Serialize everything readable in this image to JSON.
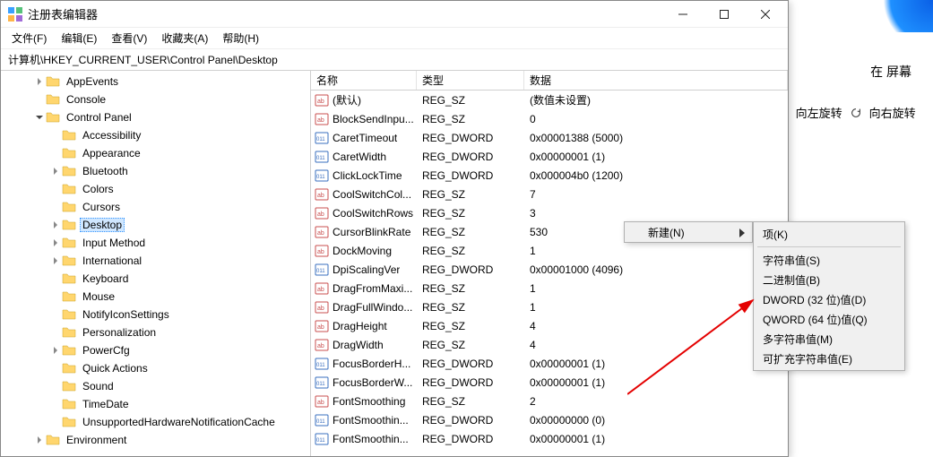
{
  "window": {
    "title": "注册表编辑器",
    "address": "计算机\\HKEY_CURRENT_USER\\Control Panel\\Desktop",
    "menu": [
      "文件(F)",
      "编辑(E)",
      "查看(V)",
      "收藏夹(A)",
      "帮助(H)"
    ]
  },
  "tree": [
    {
      "indent": 2,
      "arrow": "right",
      "label": "AppEvents"
    },
    {
      "indent": 2,
      "arrow": "none",
      "label": "Console"
    },
    {
      "indent": 2,
      "arrow": "down",
      "label": "Control Panel"
    },
    {
      "indent": 3,
      "arrow": "none",
      "label": "Accessibility"
    },
    {
      "indent": 3,
      "arrow": "none",
      "label": "Appearance"
    },
    {
      "indent": 3,
      "arrow": "right",
      "label": "Bluetooth"
    },
    {
      "indent": 3,
      "arrow": "none",
      "label": "Colors"
    },
    {
      "indent": 3,
      "arrow": "none",
      "label": "Cursors"
    },
    {
      "indent": 3,
      "arrow": "right",
      "label": "Desktop",
      "selected": true
    },
    {
      "indent": 3,
      "arrow": "right",
      "label": "Input Method"
    },
    {
      "indent": 3,
      "arrow": "right",
      "label": "International"
    },
    {
      "indent": 3,
      "arrow": "none",
      "label": "Keyboard"
    },
    {
      "indent": 3,
      "arrow": "none",
      "label": "Mouse"
    },
    {
      "indent": 3,
      "arrow": "none",
      "label": "NotifyIconSettings"
    },
    {
      "indent": 3,
      "arrow": "none",
      "label": "Personalization"
    },
    {
      "indent": 3,
      "arrow": "right",
      "label": "PowerCfg"
    },
    {
      "indent": 3,
      "arrow": "none",
      "label": "Quick Actions"
    },
    {
      "indent": 3,
      "arrow": "none",
      "label": "Sound"
    },
    {
      "indent": 3,
      "arrow": "none",
      "label": "TimeDate"
    },
    {
      "indent": 3,
      "arrow": "none",
      "label": "UnsupportedHardwareNotificationCache"
    },
    {
      "indent": 2,
      "arrow": "right",
      "label": "Environment"
    }
  ],
  "columns": {
    "name": "名称",
    "type": "类型",
    "data": "数据"
  },
  "values": [
    {
      "icon": "sz",
      "name": "(默认)",
      "type": "REG_SZ",
      "data": "(数值未设置)"
    },
    {
      "icon": "sz",
      "name": "BlockSendInpu...",
      "type": "REG_SZ",
      "data": "0"
    },
    {
      "icon": "bn",
      "name": "CaretTimeout",
      "type": "REG_DWORD",
      "data": "0x00001388 (5000)"
    },
    {
      "icon": "bn",
      "name": "CaretWidth",
      "type": "REG_DWORD",
      "data": "0x00000001 (1)"
    },
    {
      "icon": "bn",
      "name": "ClickLockTime",
      "type": "REG_DWORD",
      "data": "0x000004b0 (1200)"
    },
    {
      "icon": "sz",
      "name": "CoolSwitchCol...",
      "type": "REG_SZ",
      "data": "7"
    },
    {
      "icon": "sz",
      "name": "CoolSwitchRows",
      "type": "REG_SZ",
      "data": "3"
    },
    {
      "icon": "sz",
      "name": "CursorBlinkRate",
      "type": "REG_SZ",
      "data": "530"
    },
    {
      "icon": "sz",
      "name": "DockMoving",
      "type": "REG_SZ",
      "data": "1"
    },
    {
      "icon": "bn",
      "name": "DpiScalingVer",
      "type": "REG_DWORD",
      "data": "0x00001000 (4096)"
    },
    {
      "icon": "sz",
      "name": "DragFromMaxi...",
      "type": "REG_SZ",
      "data": "1"
    },
    {
      "icon": "sz",
      "name": "DragFullWindo...",
      "type": "REG_SZ",
      "data": "1"
    },
    {
      "icon": "sz",
      "name": "DragHeight",
      "type": "REG_SZ",
      "data": "4"
    },
    {
      "icon": "sz",
      "name": "DragWidth",
      "type": "REG_SZ",
      "data": "4"
    },
    {
      "icon": "bn",
      "name": "FocusBorderH...",
      "type": "REG_DWORD",
      "data": "0x00000001 (1)"
    },
    {
      "icon": "bn",
      "name": "FocusBorderW...",
      "type": "REG_DWORD",
      "data": "0x00000001 (1)"
    },
    {
      "icon": "sz",
      "name": "FontSmoothing",
      "type": "REG_SZ",
      "data": "2"
    },
    {
      "icon": "bn",
      "name": "FontSmoothin...",
      "type": "REG_DWORD",
      "data": "0x00000000 (0)"
    },
    {
      "icon": "bn",
      "name": "FontSmoothin...",
      "type": "REG_DWORD",
      "data": "0x00000001 (1)"
    }
  ],
  "context": {
    "new": "新建(N)",
    "items": [
      "项(K)",
      "字符串值(S)",
      "二进制值(B)",
      "DWORD (32 位)值(D)",
      "QWORD (64 位)值(Q)",
      "多字符串值(M)",
      "可扩充字符串值(E)"
    ]
  },
  "background": {
    "screen_label": "在 屏幕",
    "rotate_left": "向左旋转",
    "rotate_right": "向右旋转"
  }
}
